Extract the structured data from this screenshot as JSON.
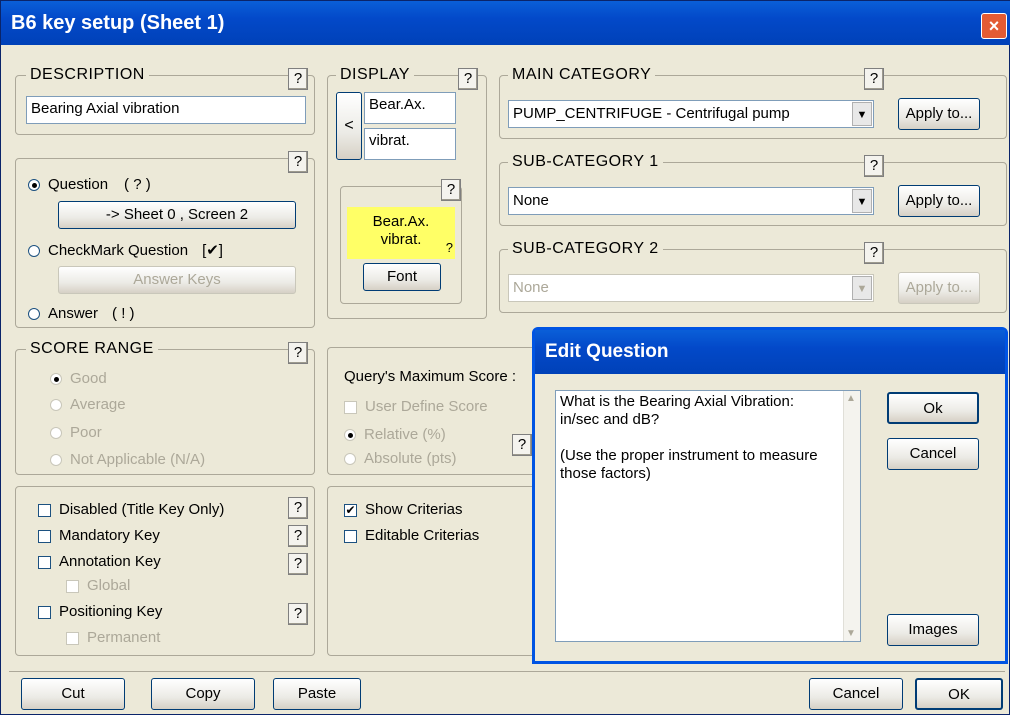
{
  "window": {
    "title": "B6 key setup (Sheet 1)",
    "close_glyph": "×"
  },
  "help_glyph": "?",
  "description": {
    "legend": "DESCRIPTION",
    "value": "Bearing Axial vibration"
  },
  "type": {
    "question_label": "Question",
    "question_marker": "( ? )",
    "sheet_button": "-> Sheet 0 , Screen 2",
    "checkmark_label": "CheckMark Question",
    "checkmark_marker": "[✔]",
    "answer_keys_button": "Answer Keys",
    "answer_label": "Answer",
    "answer_marker": "( ! )"
  },
  "display": {
    "legend": "DISPLAY",
    "arrow_glyph": "<",
    "line1": "Bear.Ax.",
    "line2": "vibrat.",
    "preview_line1": "Bear.Ax.",
    "preview_line2": "vibrat.",
    "preview_marker": "?",
    "font_button": "Font",
    "preview_bg": "#ffff66"
  },
  "main_category": {
    "legend": "MAIN CATEGORY",
    "value": "PUMP_CENTRIFUGE - Centrifugal pump",
    "apply_button": "Apply to..."
  },
  "sub_category_1": {
    "legend": "SUB-CATEGORY 1",
    "value": "None",
    "apply_button": "Apply to..."
  },
  "sub_category_2": {
    "legend": "SUB-CATEGORY 2",
    "value": "None",
    "apply_button": "Apply to..."
  },
  "score_range": {
    "legend": "SCORE RANGE",
    "options": [
      "Good",
      "Average",
      "Poor",
      "Not Applicable (N/A)"
    ]
  },
  "max_score": {
    "label": "Query's Maximum Score :",
    "user_define": "User Define Score",
    "relative": "Relative (%)",
    "absolute": "Absolute (pts)"
  },
  "flags": {
    "disabled": "Disabled (Title Key Only)",
    "mandatory": "Mandatory Key",
    "annotation": "Annotation Key",
    "global": "Global",
    "positioning": "Positioning Key",
    "permanent": "Permanent"
  },
  "criterias": {
    "show": "Show Criterias",
    "editable": "Editable Criterias",
    "check_glyph": "✔"
  },
  "footer": {
    "cut": "Cut",
    "copy": "Copy",
    "paste": "Paste",
    "cancel": "Cancel",
    "ok": "OK"
  },
  "edit_question": {
    "title": "Edit Question",
    "text_lines": [
      "What is the Bearing Axial  Vibration:",
      "in/sec and dB?",
      "",
      "(Use the proper instrument to measure",
      "those factors)"
    ],
    "ok_button": "Ok",
    "cancel_button": "Cancel",
    "images_button": "Images"
  }
}
